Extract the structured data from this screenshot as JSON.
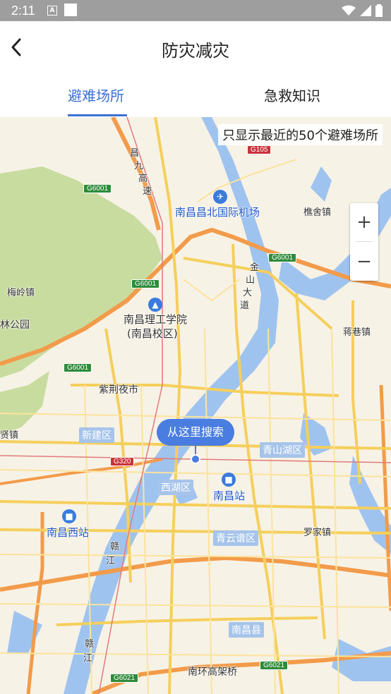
{
  "status_bar": {
    "time": "2:11",
    "notif_letter": "A"
  },
  "header": {
    "title": "防灾减灾"
  },
  "tabs": [
    {
      "label": "避难场所",
      "active": true
    },
    {
      "label": "急救知识",
      "active": false
    }
  ],
  "map": {
    "notice": "只显示最近的50个避难场所",
    "zoom_in": "+",
    "zoom_out": "−",
    "search_bubble": "从这里搜索",
    "labels": {
      "airport": "南昌昌北国际机场",
      "qiaoshe": "樵舍镇",
      "meiling": "梅岭镇",
      "forest_park": "林公园",
      "ligong": "南昌理工学院",
      "ligong_campus": "(南昌校区)",
      "jiangxiang": "蒋巷镇",
      "zijing": "紫荆夜市",
      "xian": "贤镇",
      "luojia": "罗家镇",
      "nanhuan": "南环高架桥",
      "changjiu1": "昌",
      "changjiu2": "九",
      "changjiu3": "高",
      "changjiu4": "速",
      "jinshan1": "金",
      "jinshan2": "山",
      "jinshan3": "大",
      "jinshan4": "道",
      "gan1": "赣",
      "gan2": "江",
      "gan3": "赣",
      "gan4": "江"
    },
    "districts": {
      "xinjian": "新建区",
      "qingshanhu": "青山湖区",
      "xihu": "西湖区",
      "qingyunpu": "青云谱区",
      "nanchangxian": "南昌县"
    },
    "stations": {
      "nanchang": "南昌站",
      "nanchang_west": "南昌西站"
    },
    "roads": {
      "g105": "G105",
      "g6001_a": "G6001",
      "g6001_b": "G6001",
      "g6001_c": "G6001",
      "g6001_d": "G6001",
      "g320": "G320",
      "g6021_a": "G6021",
      "g6021_b": "G6021"
    }
  }
}
